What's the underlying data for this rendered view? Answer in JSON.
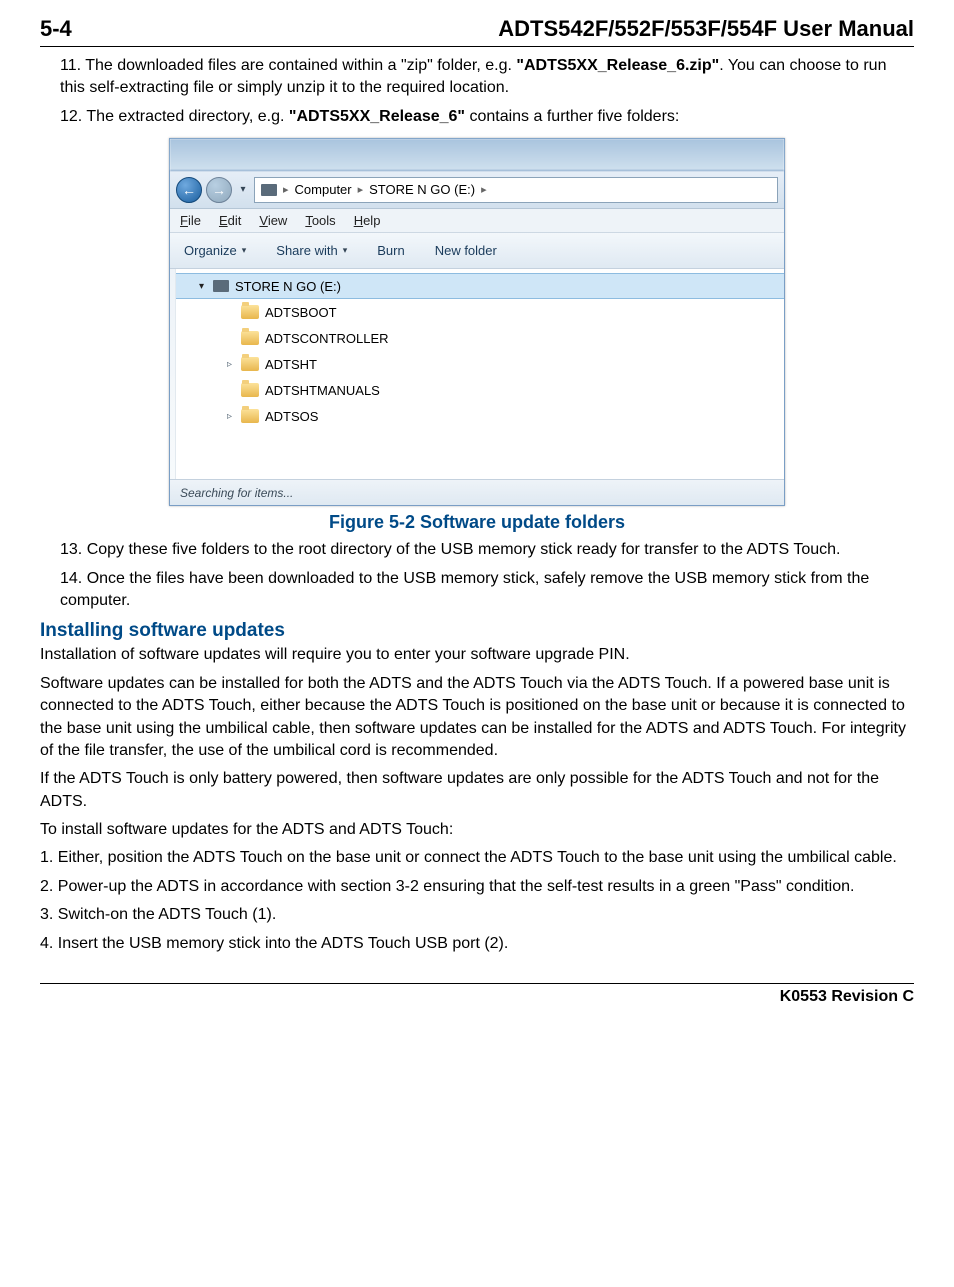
{
  "header": {
    "page": "5-4",
    "title": "ADTS542F/552F/553F/554F User Manual"
  },
  "step11_a": "11. The downloaded files are contained within a \"zip\" folder, e.g. ",
  "step11_bold": "\"ADTS5XX_Release_6.zip\"",
  "step11_b": ". You can choose to run this self-extracting file or simply unzip it to the required location.",
  "step12_a": "12. The extracted directory, e.g. ",
  "step12_bold": "\"ADTS5XX_Release_6\"",
  "step12_b": " contains a further five folders:",
  "explorer": {
    "addr_computer": "Computer",
    "addr_drive": "STORE N GO (E:)",
    "menu": {
      "file": "File",
      "edit": "Edit",
      "view": "View",
      "tools": "Tools",
      "help": "Help"
    },
    "toolbar": {
      "organize": "Organize",
      "share": "Share with",
      "burn": "Burn",
      "newfolder": "New folder"
    },
    "tree_root": "STORE N GO (E:)",
    "folders": [
      "ADTSBOOT",
      "ADTSCONTROLLER",
      "ADTSHT",
      "ADTSHTMANUALS",
      "ADTSOS"
    ],
    "status": "Searching for items..."
  },
  "figure_caption": "Figure 5-2 Software update folders",
  "step13": "13. Copy these five folders to the root directory of the USB memory stick ready for transfer to the ADTS Touch.",
  "step14": "14. Once the files have been downloaded to the USB memory stick, safely remove the USB memory stick from the computer.",
  "heading_install": "Installing software updates",
  "p_install_1": "Installation of software updates will require you to enter your software upgrade PIN.",
  "p_install_2": "Software updates can be installed for both the ADTS and the ADTS Touch via the ADTS Touch. If a powered base unit is connected to the ADTS Touch, either because the ADTS Touch is positioned on the base unit or because it is connected to the base unit using the umbilical cable, then software updates can be installed for the ADTS and ADTS Touch. For integrity of the file transfer, the use of the umbilical cord is recommended.",
  "p_install_3": "If the ADTS Touch is only battery powered, then software updates are only possible for the ADTS Touch and not for the ADTS.",
  "p_install_4": "To install software updates for the ADTS and ADTS Touch:",
  "install_steps": [
    "1. Either, position the ADTS Touch on the base unit or connect the ADTS Touch to the base unit using the umbilical cable.",
    "2. Power-up the ADTS in accordance with section 3-2 ensuring that the self-test results in a green \"Pass\" condition.",
    "3. Switch-on the ADTS Touch (1).",
    "4. Insert the USB memory stick into the ADTS Touch USB port (2)."
  ],
  "footer": "K0553 Revision C"
}
